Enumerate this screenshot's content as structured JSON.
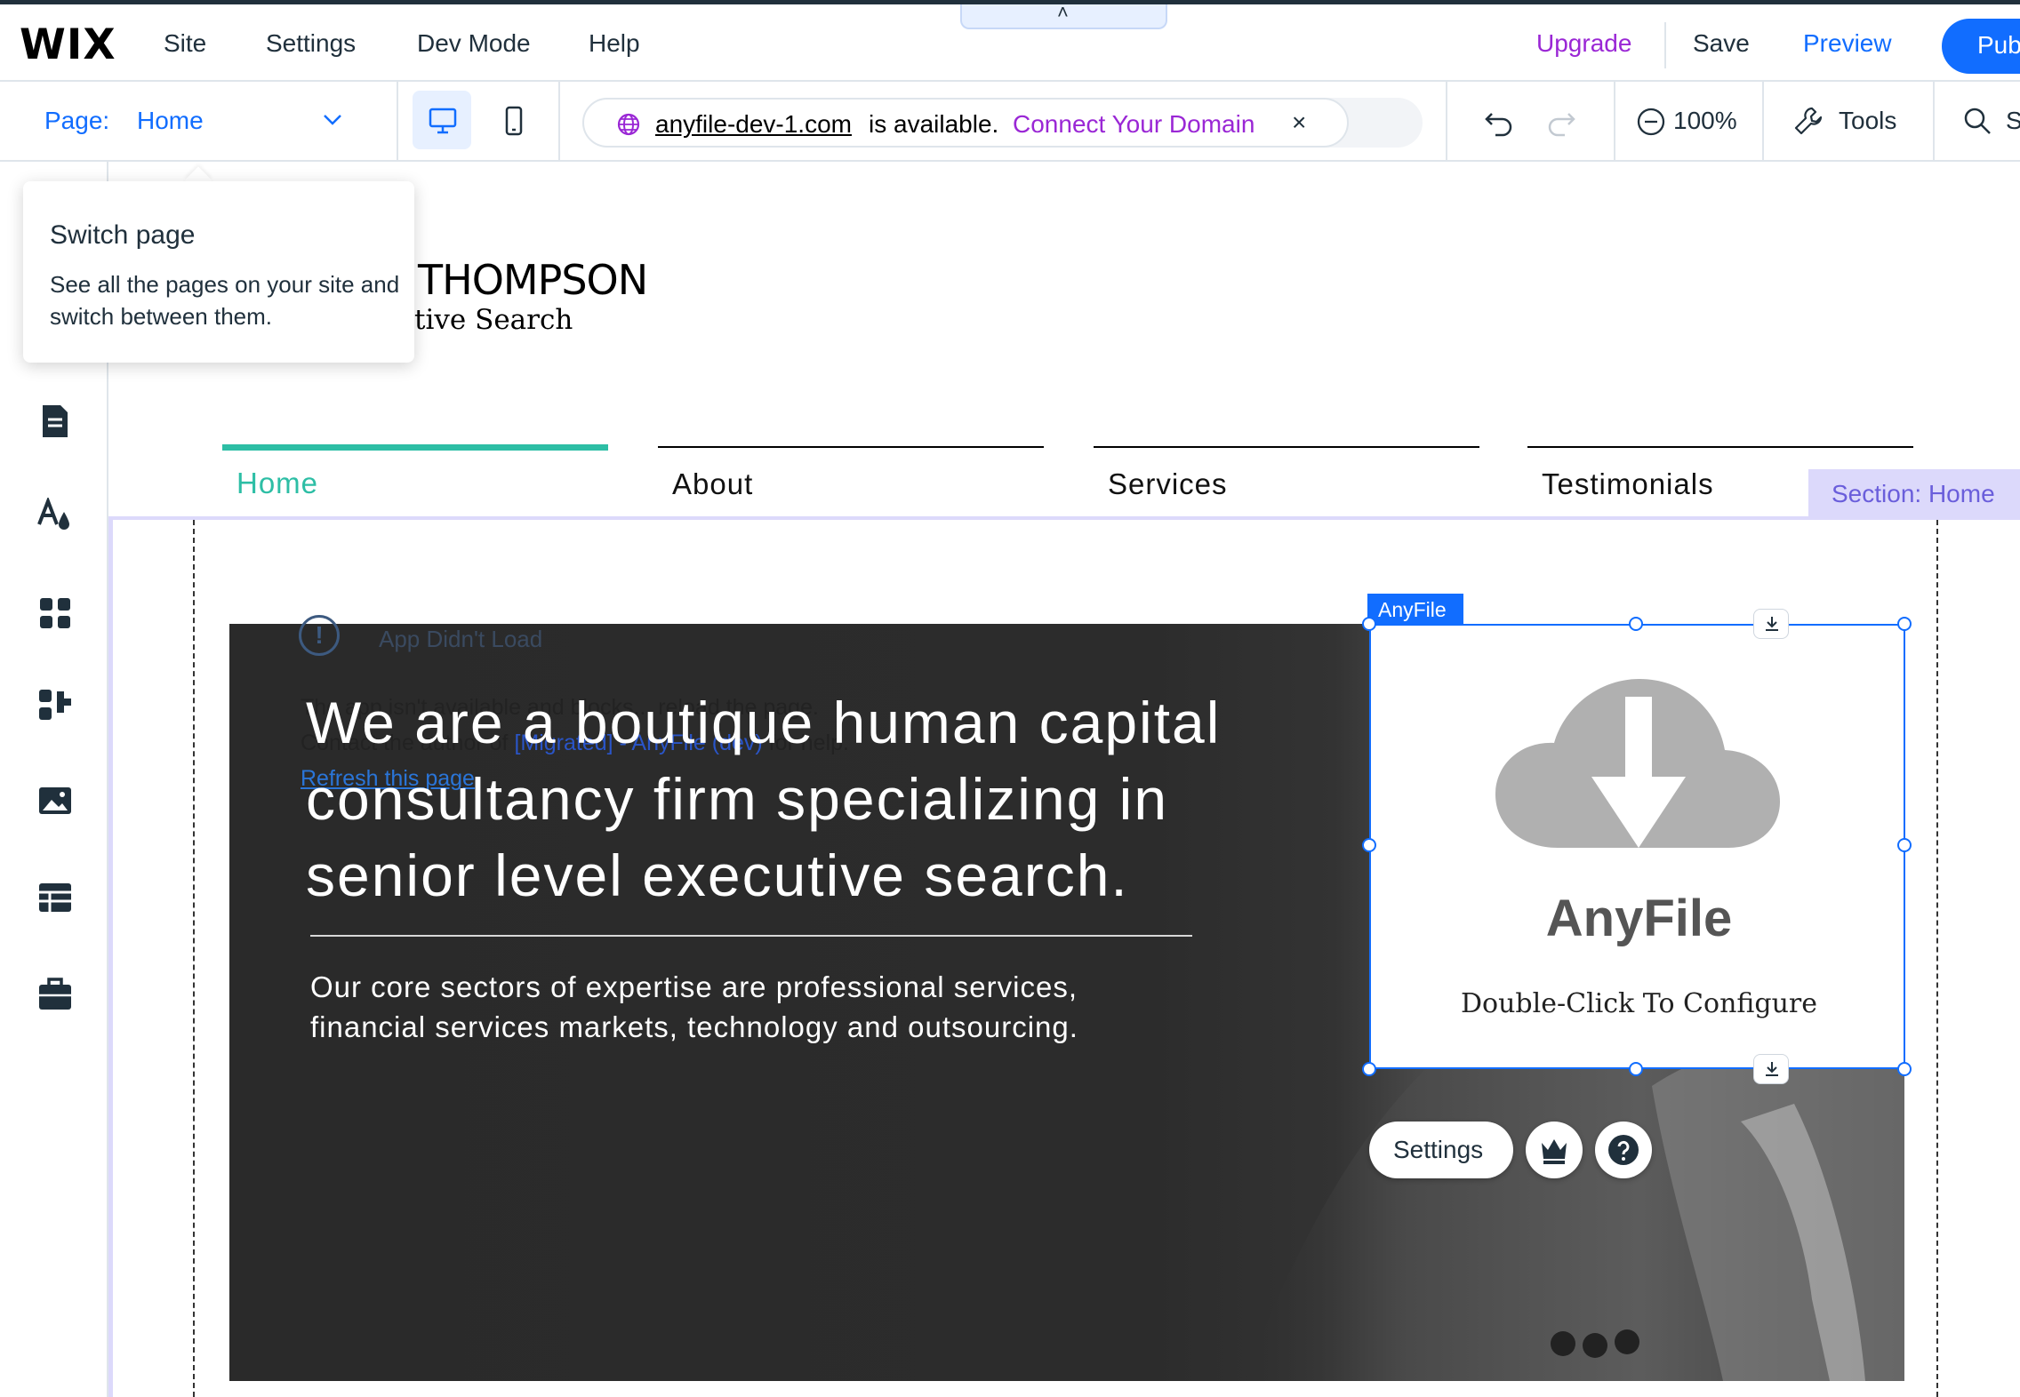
{
  "topbar": {
    "logo": "WIX",
    "menu": [
      {
        "label": "Site"
      },
      {
        "label": "Settings"
      },
      {
        "label": "Dev Mode"
      },
      {
        "label": "Help"
      }
    ],
    "upgrade": "Upgrade",
    "save": "Save",
    "preview": "Preview",
    "publish": "Pub",
    "collapse_glyph": "˄"
  },
  "toolbar": {
    "page_label": "Page:",
    "page_value": "Home",
    "domain": {
      "name": "anyfile-dev-1.com",
      "available_text": "is available.",
      "connect_label": "Connect Your Domain",
      "close_glyph": "×"
    },
    "zoom": "100%",
    "tools_label": "Tools",
    "search_label": "S"
  },
  "tooltip": {
    "title": "Switch page",
    "body": "See all the pages on your site and switch between them."
  },
  "site": {
    "logo_name": "THOMPSON",
    "logo_sub": "tive Search",
    "nav": [
      {
        "label": "Home",
        "active": true
      },
      {
        "label": "About",
        "active": false
      },
      {
        "label": "Services",
        "active": false
      },
      {
        "label": "Testimonials",
        "active": false
      }
    ],
    "section_label": "Section: Home",
    "hero": {
      "title": "We are a boutique human capital consultancy firm specializing in senior level executive search.",
      "body": "Our core sectors of expertise are professional services, financial services markets, technology and outsourcing."
    },
    "app_error": {
      "icon": "!",
      "title": "App Didn't Load",
      "line1": "The app isn't available and blocks... reload the page.",
      "line2_pre": "Contact the author of",
      "line2_link": "[Migrated] - AnyFile (dev)",
      "line2_post": "for help.",
      "refresh": "Refresh this page"
    }
  },
  "widget": {
    "tag": "AnyFile",
    "name": "AnyFile",
    "cta": "Double-Click To Configure",
    "settings_label": "Settings"
  },
  "colors": {
    "accent_blue": "#116dff",
    "upgrade_purple": "#9a27d5",
    "nav_active": "#2dbea5",
    "section_purple": "#6a5edb"
  }
}
